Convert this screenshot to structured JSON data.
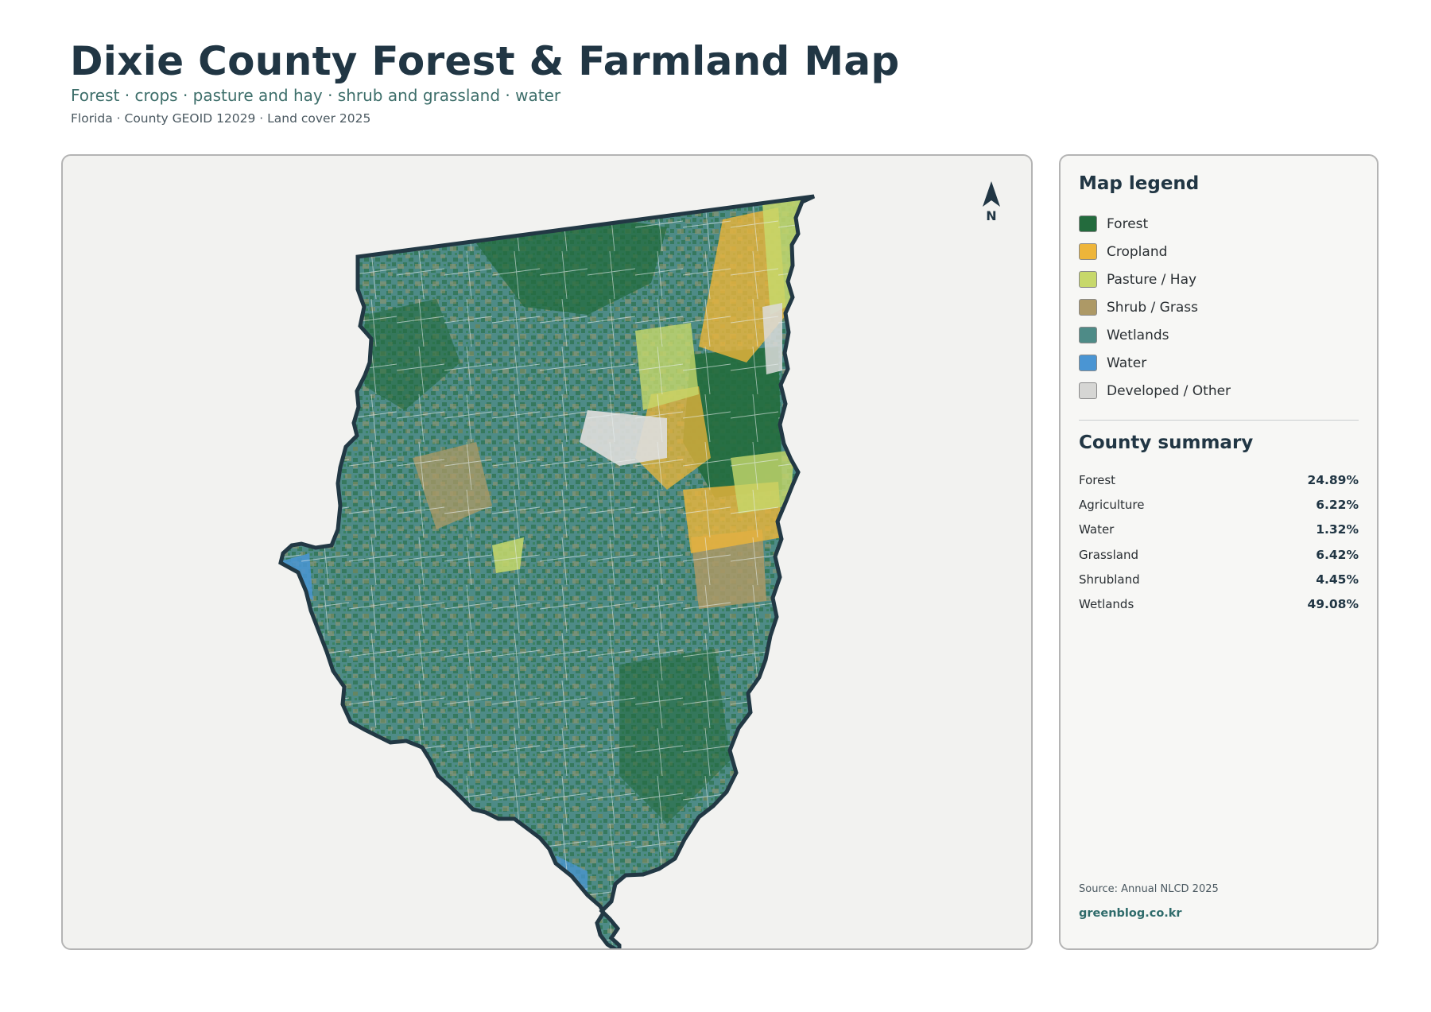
{
  "header": {
    "title": "Dixie County Forest & Farmland Map",
    "subtitle": "Forest · crops · pasture and hay · shrub and grassland · water",
    "meta": "Florida · County GEOID 12029 · Land cover 2025"
  },
  "map": {
    "north_label": "N",
    "colors": {
      "wetlands": "#4e8b87",
      "forest": "#236b3d",
      "cropland": "#eeb53a",
      "pasture": "#c7d86b",
      "shrub": "#ad9966",
      "water": "#4a95d3",
      "developed": "#dcdcda",
      "outline": "#223844"
    }
  },
  "legend": {
    "heading": "Map legend",
    "items": [
      {
        "label": "Forest",
        "color": "#236b3d"
      },
      {
        "label": "Cropland",
        "color": "#eeb53a"
      },
      {
        "label": "Pasture / Hay",
        "color": "#c7d86b"
      },
      {
        "label": "Shrub / Grass",
        "color": "#ad9966"
      },
      {
        "label": "Wetlands",
        "color": "#4e8b87"
      },
      {
        "label": "Water",
        "color": "#4a95d3"
      },
      {
        "label": "Developed / Other",
        "color": "#d6d6d4"
      }
    ]
  },
  "summary": {
    "heading": "County summary",
    "rows": [
      {
        "label": "Forest",
        "value": "24.89%"
      },
      {
        "label": "Agriculture",
        "value": "6.22%"
      },
      {
        "label": "Water",
        "value": "1.32%"
      },
      {
        "label": "Grassland",
        "value": "6.42%"
      },
      {
        "label": "Shrubland",
        "value": "4.45%"
      },
      {
        "label": "Wetlands",
        "value": "49.08%"
      }
    ]
  },
  "footer": {
    "source": "Source: Annual NLCD 2025",
    "site": "greenblog.co.kr"
  }
}
